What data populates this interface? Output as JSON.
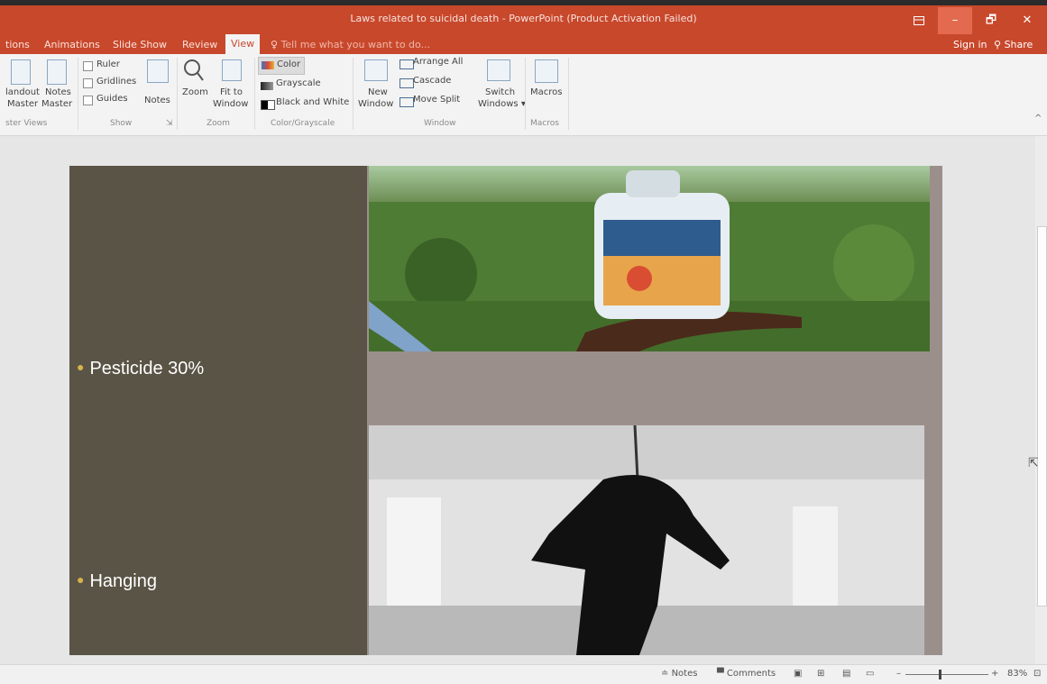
{
  "window": {
    "title": "Laws related to suicidal death - PowerPoint (Product Activation Failed)",
    "options_icon": "ribbon-display-icon",
    "minimize": "–",
    "maximize": "🗗",
    "close": "✕"
  },
  "tabs": [
    {
      "label": "tions"
    },
    {
      "label": "Animations"
    },
    {
      "label": "Slide Show"
    },
    {
      "label": "Review"
    },
    {
      "label": "View"
    }
  ],
  "tell_me": "Tell me what you want to do...",
  "sign_in": "Sign in",
  "share": "Share",
  "ribbon": {
    "master_views": {
      "handout_master": [
        "landout",
        "Master"
      ],
      "notes_master": [
        "Notes",
        "Master"
      ],
      "group_label": "ster Views"
    },
    "show": {
      "ruler": "Ruler",
      "gridlines": "Gridlines",
      "guides": "Guides",
      "notes": "Notes",
      "group_label": "Show"
    },
    "zoom": {
      "zoom": "Zoom",
      "fit_to_window": [
        "Fit to",
        "Window"
      ],
      "group_label": "Zoom"
    },
    "color_grayscale": {
      "color": "Color",
      "grayscale": "Grayscale",
      "black_and_white": "Black and White",
      "group_label": "Color/Grayscale"
    },
    "window": {
      "new_window": [
        "New",
        "Window"
      ],
      "arrange_all": "Arrange All",
      "cascade": "Cascade",
      "move_split": "Move Split",
      "switch_windows": [
        "Switch",
        "Windows ▾"
      ],
      "group_label": "Window"
    },
    "macros": {
      "macros": "Macros",
      "group_label": "Macros"
    },
    "collapse": "^"
  },
  "slide": {
    "bullets": [
      "Pesticide 30%",
      "Hanging"
    ],
    "accent_bullet_color": "#d8b24a",
    "left_panel_color": "#5a5446"
  },
  "statusbar": {
    "notes": "Notes",
    "comments": "Comments",
    "zoom_level": "83%",
    "minus": "–",
    "plus": "+"
  },
  "colors": {
    "accent": "#c8482c",
    "ribbon_bg": "#f3f3f3"
  }
}
